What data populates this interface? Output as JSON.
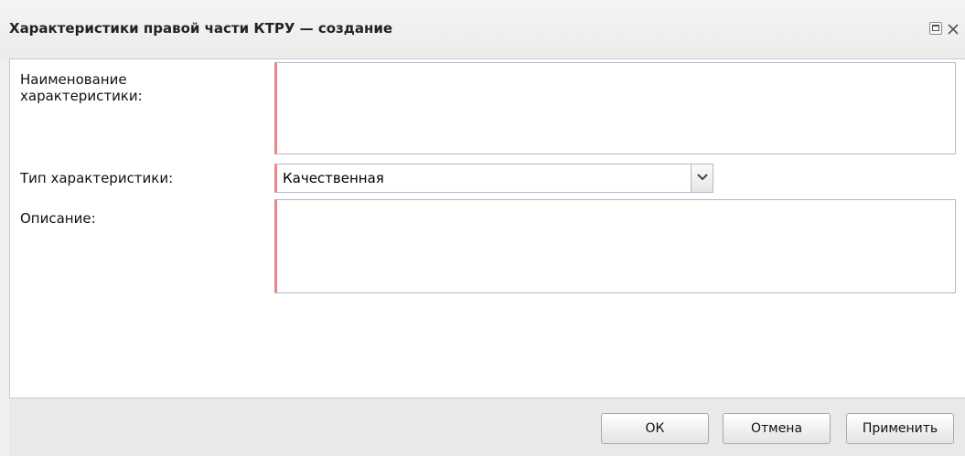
{
  "window": {
    "title": "Характеристики правой части КТРУ — создание"
  },
  "form": {
    "name_label": "Наименование характеристики:",
    "name_value": "",
    "type_label": "Тип характеристики:",
    "type_value": "Качественная",
    "description_label": "Описание:",
    "description_value": ""
  },
  "buttons": {
    "ok": "ОК",
    "cancel": "Отмена",
    "apply": "Применить"
  },
  "icons": {
    "maximize": "maximize-icon",
    "close": "close-icon",
    "dropdown": "chevron-down-icon"
  },
  "colors": {
    "required_marker": "#e48a8a",
    "field_border": "#b5b8c8"
  }
}
